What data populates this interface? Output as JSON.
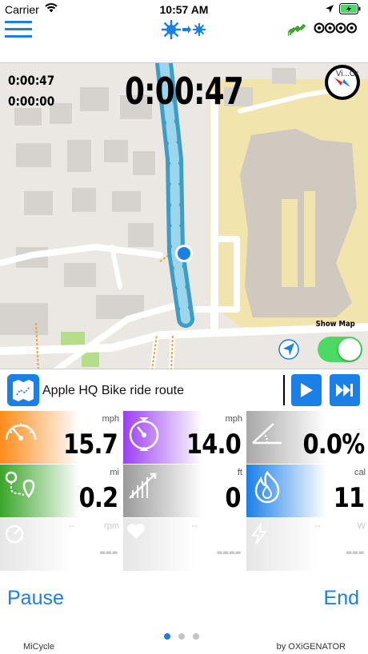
{
  "status_bar": {
    "carrier": "Carrier",
    "time": "10:57 AM"
  },
  "map": {
    "timer_main": "0:00:47",
    "timer_elapsed": "0:00:47",
    "timer_secondary": "0:00:00",
    "corner_label": "Vi...Or",
    "show_map_label": "Show Map",
    "show_map_on": true
  },
  "route": {
    "label": "Apple HQ Bike ride route"
  },
  "metrics": [
    {
      "id": "speed",
      "unit": "mph",
      "value": "15.7",
      "color": "#ff8c1a",
      "icon": "speedometer-icon"
    },
    {
      "id": "avg-speed",
      "unit": "mph",
      "value": "14.0",
      "color": "#9b3ff0",
      "icon": "avg-speedometer-icon"
    },
    {
      "id": "grade",
      "unit": "",
      "value": "0.0%",
      "color": "#a0a0a0",
      "icon": "grade-angle-icon"
    },
    {
      "id": "distance",
      "unit": "mi",
      "value": "0.2",
      "color": "#3aa52a",
      "icon": "distance-route-icon"
    },
    {
      "id": "elevation",
      "unit": "ft",
      "value": "0",
      "color": "#9a9a9a",
      "icon": "elevation-icon"
    },
    {
      "id": "calories",
      "unit": "cal",
      "value": "11",
      "color": "#1b7fe8",
      "icon": "flame-icon"
    },
    {
      "id": "cadence",
      "unit": "rpm",
      "value": "---",
      "color": "#e6e6e6",
      "icon": "cadence-icon",
      "dim": true,
      "top": "--"
    },
    {
      "id": "heart-rate",
      "unit": "",
      "value": "----",
      "color": "#e6e6e6",
      "icon": "heart-icon",
      "dim": true,
      "top": "--"
    },
    {
      "id": "power",
      "unit": "W",
      "value": "---",
      "color": "#e6e6e6",
      "icon": "lightning-icon",
      "dim": true,
      "top": "--"
    }
  ],
  "controls": {
    "pause_label": "Pause",
    "end_label": "End"
  },
  "page_indicator": {
    "count": 3,
    "active": 0
  },
  "footer": {
    "app_name": "MiCycle",
    "brand": "by OXiGENATOR"
  },
  "colors": {
    "accent": "#1b7fe8",
    "toggle_on": "#4cd964",
    "route_path": "#4bb3d9"
  }
}
